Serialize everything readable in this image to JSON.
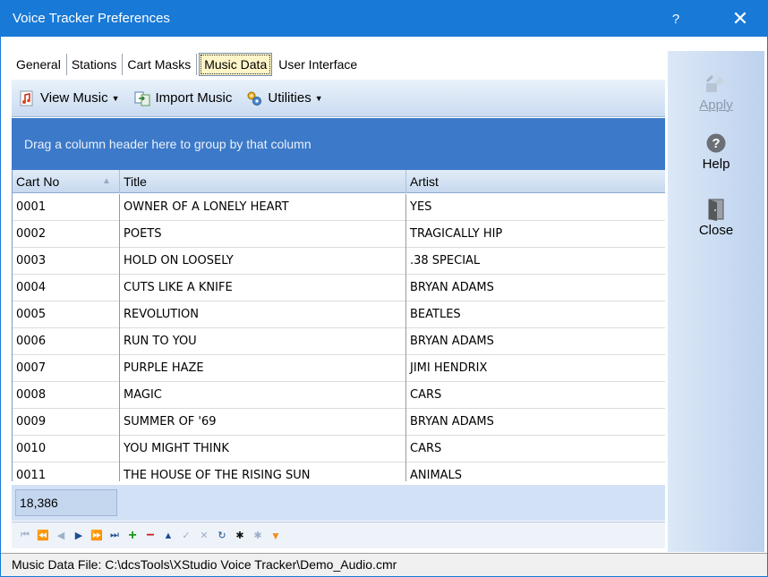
{
  "window": {
    "title": "Voice Tracker Preferences",
    "help_glyph": "?",
    "close_glyph": "✕"
  },
  "tabs": [
    {
      "label": "General"
    },
    {
      "label": "Stations"
    },
    {
      "label": "Cart Masks"
    },
    {
      "label": "Music Data",
      "active": true
    },
    {
      "label": "User Interface"
    }
  ],
  "toolbar": {
    "view_music": "View Music",
    "import_music": "Import Music",
    "utilities": "Utilities"
  },
  "group_panel": {
    "hint": "Drag a column header here to group by that column"
  },
  "grid": {
    "columns": [
      "Cart No",
      "Title",
      "Artist"
    ],
    "sorted_column": "Cart No",
    "rows": [
      [
        "0001",
        "OWNER OF A LONELY HEART",
        "YES"
      ],
      [
        "0002",
        "POETS",
        "TRAGICALLY HIP"
      ],
      [
        "0003",
        "HOLD ON LOOSELY",
        ".38 SPECIAL"
      ],
      [
        "0004",
        "CUTS LIKE A KNIFE",
        "BRYAN ADAMS"
      ],
      [
        "0005",
        "REVOLUTION",
        "BEATLES"
      ],
      [
        "0006",
        "RUN TO YOU",
        "BRYAN ADAMS"
      ],
      [
        "0007",
        "PURPLE HAZE",
        "JIMI HENDRIX"
      ],
      [
        "0008",
        "MAGIC",
        "CARS"
      ],
      [
        "0009",
        "SUMMER OF '69",
        "BRYAN ADAMS"
      ],
      [
        "0010",
        "YOU MIGHT THINK",
        "CARS"
      ],
      [
        "0011",
        "THE HOUSE OF THE RISING SUN",
        "ANIMALS"
      ]
    ],
    "record_count": "18,386"
  },
  "navigator": [
    "first-icon",
    "prev-page-icon",
    "prev-icon",
    "next-icon",
    "next-page-icon",
    "last-icon",
    "add-icon",
    "delete-icon",
    "edit-icon",
    "post-icon",
    "cancel-icon",
    "refresh-icon",
    "filter-icon",
    "clear-filter-icon",
    "bookmark-icon"
  ],
  "sidebar": {
    "apply": "Apply",
    "help": "Help",
    "close": "Close"
  },
  "status": {
    "text": "Music Data File: C:\\dcsTools\\XStudio Voice Tracker\\Demo_Audio.cmr"
  }
}
